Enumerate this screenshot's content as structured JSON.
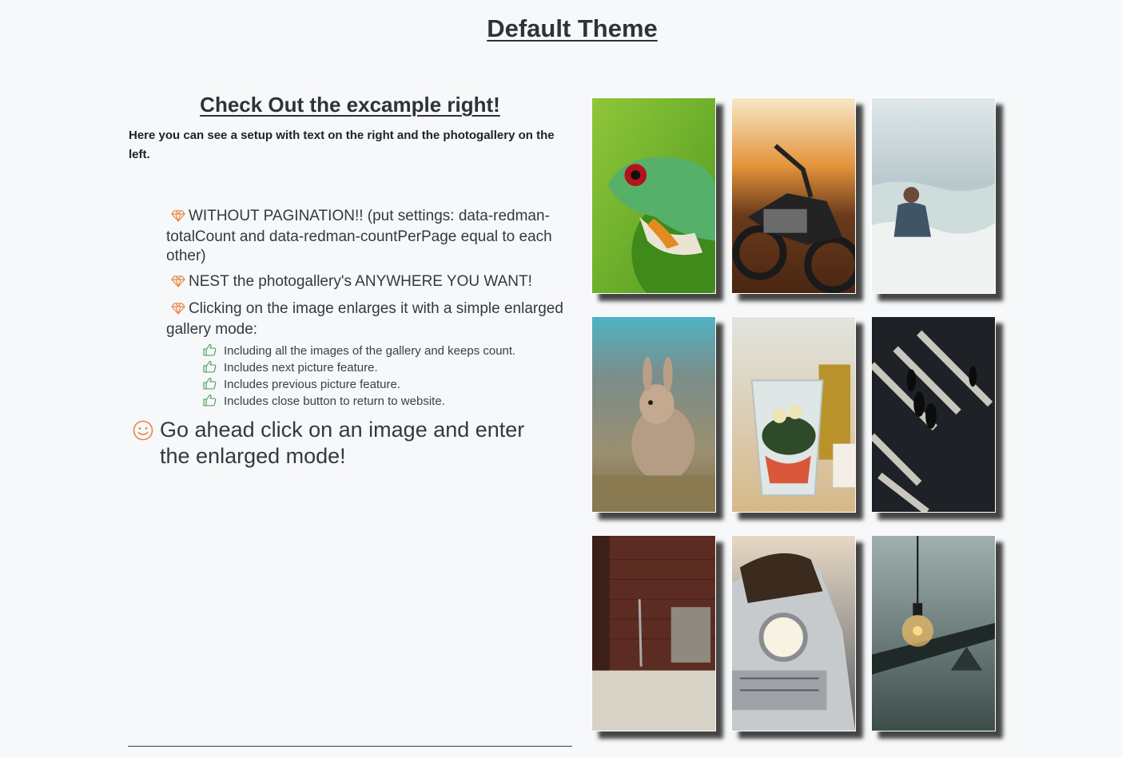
{
  "page": {
    "title": "Default Theme"
  },
  "content": {
    "heading": "Check Out the excample right!",
    "intro": "Here you can see a setup with text on the right and the photogallery on the left.",
    "features": [
      {
        "icon": "gem-icon",
        "text": "WITHOUT PAGINATION!! (put settings: data-redman-totalCount and data-redman-countPerPage equal to each other)"
      },
      {
        "icon": "gem-icon",
        "text": "NEST the photogallery's ANYWHERE YOU WANT!"
      },
      {
        "icon": "gem-icon",
        "text": "Clicking on the image enlarges it with a simple enlarged gallery mode:"
      }
    ],
    "subfeatures": [
      {
        "icon": "thumbs-up-icon",
        "text": "Including all the images of the gallery and keeps count."
      },
      {
        "icon": "thumbs-up-icon",
        "text": "Includes next picture feature."
      },
      {
        "icon": "thumbs-up-icon",
        "text": "Includes previous picture feature."
      },
      {
        "icon": "thumbs-up-icon",
        "text": "Includes close button to return to website."
      }
    ],
    "cta": {
      "icon": "smiley-icon",
      "text": "Go ahead click on an image and enter the enlarged mode!"
    }
  },
  "gallery": {
    "images": [
      {
        "subject": "tree frog"
      },
      {
        "subject": "motorcycle at sunset"
      },
      {
        "subject": "man in sea waves"
      },
      {
        "subject": "rabbit on grass"
      },
      {
        "subject": "blender with fruit"
      },
      {
        "subject": "people on crosswalk"
      },
      {
        "subject": "brick room with broom"
      },
      {
        "subject": "vintage car headlight"
      },
      {
        "subject": "hanging light bulb"
      }
    ]
  },
  "colors": {
    "background": "#f7f8f9",
    "text": "#2f3337",
    "gem_accent": "#e8864a",
    "thumb_accent": "#3f9b52",
    "smile_accent": "#e8864a"
  }
}
